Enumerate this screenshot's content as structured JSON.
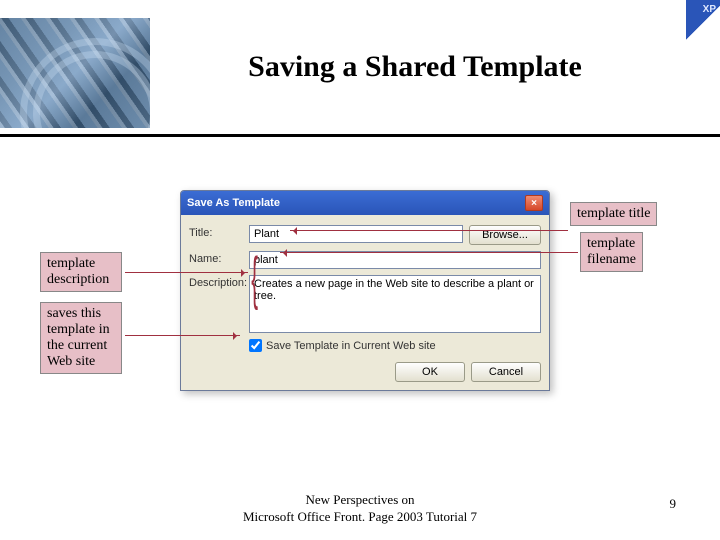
{
  "slide": {
    "title": "Saving a Shared Template",
    "corner_badge": "XP",
    "page_number": "9",
    "footer_line1": "New Perspectives on",
    "footer_line2": "Microsoft Office Front. Page 2003 Tutorial 7"
  },
  "dialog": {
    "titlebar": "Save As Template",
    "labels": {
      "title": "Title:",
      "name": "Name:",
      "description": "Description:"
    },
    "fields": {
      "title": "Plant",
      "name": "plant",
      "description": "Creates a new page in the Web site to describe a plant or tree."
    },
    "checkbox_label": "Save Template in Current Web site",
    "checkbox_checked": true,
    "buttons": {
      "browse": "Browse...",
      "ok": "OK",
      "cancel": "Cancel"
    }
  },
  "callouts": {
    "left_desc": "template\ndescription",
    "left_save": "saves this\ntemplate in\nthe current\nWeb site",
    "right_title": "template title",
    "right_name": "template\nfilename"
  }
}
